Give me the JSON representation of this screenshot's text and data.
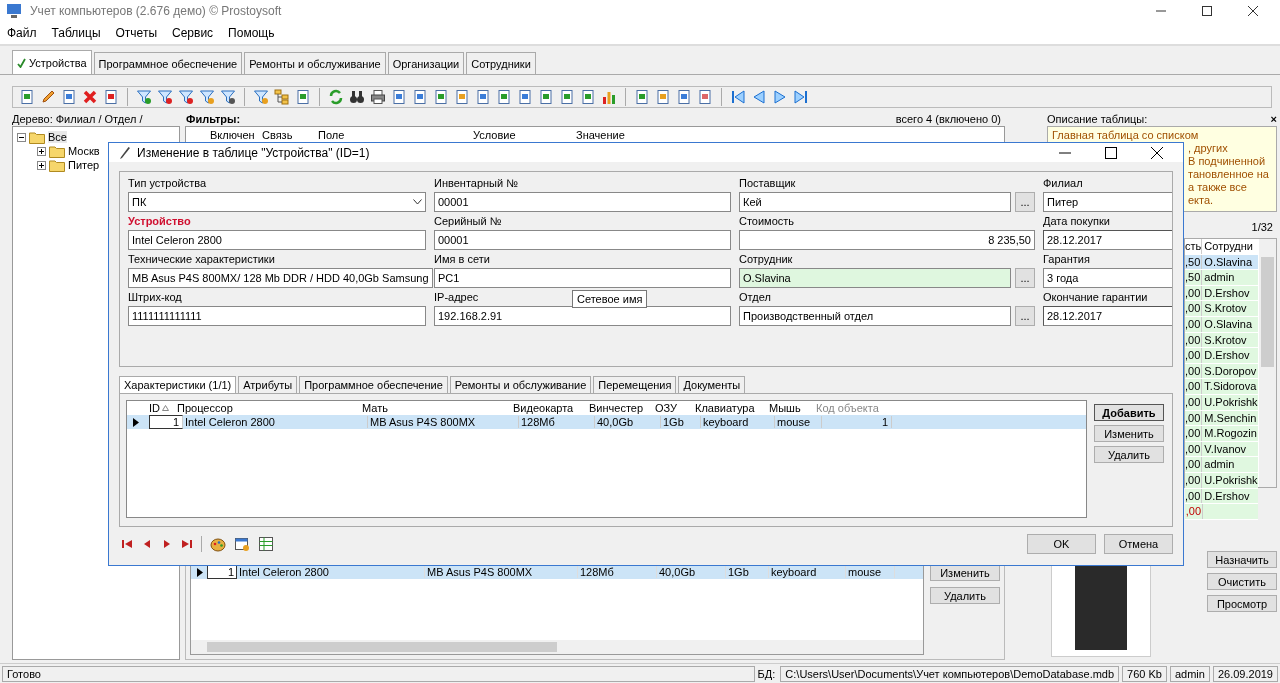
{
  "window": {
    "title": "Учет компьютеров (2.676 демо) © Prostoysoft"
  },
  "menu": [
    "Файл",
    "Таблицы",
    "Отчеты",
    "Сервис",
    "Помощь"
  ],
  "tabs": [
    {
      "label": "Устройства",
      "selected": true
    },
    {
      "label": "Программное обеспечение",
      "selected": false
    },
    {
      "label": "Ремонты и обслуживание",
      "selected": false
    },
    {
      "label": "Организации",
      "selected": false
    },
    {
      "label": "Сотрудники",
      "selected": false
    }
  ],
  "tree": {
    "title": "Дерево: Филиал / Отдел /",
    "items": [
      {
        "label": "Все",
        "expanded": true,
        "selected": true,
        "children": [
          {
            "label": "Москв",
            "expanded": false,
            "selected": false
          },
          {
            "label": "Питер",
            "expanded": false,
            "selected": false
          }
        ]
      }
    ]
  },
  "filters": {
    "title": "Фильтры:",
    "summary": "всего 4 (включено 0)",
    "columns": [
      "Включен",
      "Связь",
      "Поле",
      "Условие",
      "Значение"
    ]
  },
  "description": {
    "title": "Описание таблицы:",
    "close": "×",
    "lines": [
      "Главная таблица со списком",
      ", других",
      "В подчиненной",
      "тановленное на",
      "а также все",
      "екта."
    ]
  },
  "employees": {
    "counter": "1/32",
    "columns": [
      "сть",
      "Сотрудни"
    ],
    "rows": [
      {
        "cost": ",50",
        "name": "O.Slavina",
        "selected": true,
        "highlighted": false
      },
      {
        "cost": ",50",
        "name": "admin",
        "selected": false,
        "highlighted": false
      },
      {
        "cost": ",00",
        "name": "D.Ershov",
        "selected": false,
        "highlighted": false
      },
      {
        "cost": ",00",
        "name": "S.Krotov",
        "selected": false,
        "highlighted": false
      },
      {
        "cost": ",00",
        "name": "O.Slavina",
        "selected": false,
        "highlighted": false
      },
      {
        "cost": ",00",
        "name": "S.Krotov",
        "selected": false,
        "highlighted": false
      },
      {
        "cost": ",00",
        "name": "D.Ershov",
        "selected": false,
        "highlighted": false
      },
      {
        "cost": ",00",
        "name": "S.Doropov",
        "selected": false,
        "highlighted": false
      },
      {
        "cost": ",00",
        "name": "T.Sidorova",
        "selected": false,
        "highlighted": false
      },
      {
        "cost": ",00",
        "name": "U.Pokrishk",
        "selected": false,
        "highlighted": false
      },
      {
        "cost": ",00",
        "name": "M.Senchin",
        "selected": false,
        "highlighted": false
      },
      {
        "cost": ",00",
        "name": "M.Rogozin",
        "selected": false,
        "highlighted": false
      },
      {
        "cost": ",00",
        "name": "V.Ivanov",
        "selected": false,
        "highlighted": false
      },
      {
        "cost": ",00",
        "name": "admin",
        "selected": false,
        "highlighted": false
      },
      {
        "cost": ",00",
        "name": "U.Pokrishk",
        "selected": false,
        "highlighted": false
      },
      {
        "cost": ",00",
        "name": "D.Ershov",
        "selected": false,
        "highlighted": false
      },
      {
        "cost": ",00",
        "selected": false,
        "highlighted": true
      }
    ]
  },
  "devices": {
    "rows": [
      {
        "cells": [
          "1",
          "Intel Celeron 2800",
          "MB Asus P4S 800MX",
          "128Мб",
          "40,0Gb",
          "1Gb",
          "keyboard",
          "mouse"
        ],
        "selected": true
      }
    ],
    "buttons": [
      "Изменить",
      "Удалить"
    ]
  },
  "photo": {
    "buttons": [
      "Назначить",
      "Очистить",
      "Просмотр"
    ]
  },
  "dialog": {
    "title": "Изменение в таблице \"Устройства\" (ID=1)",
    "fields": [
      {
        "label": "Тип устройства",
        "value": "ПК",
        "kind": "dropdown",
        "required": false,
        "highlighted": false
      },
      {
        "label": "Инвентарный №",
        "value": "00001",
        "kind": "text",
        "required": false,
        "highlighted": false
      },
      {
        "label": "Поставщик",
        "value": "Кей",
        "kind": "lookup",
        "button": "...",
        "required": false,
        "highlighted": false
      },
      {
        "label": "Филиал",
        "value": "Питер",
        "kind": "text",
        "required": false,
        "highlighted": false
      },
      {
        "label": "Устройство",
        "value": "Intel Celeron 2800",
        "kind": "text",
        "required": true,
        "highlighted": false
      },
      {
        "label": "Серийный №",
        "value": "00001",
        "kind": "text",
        "required": false,
        "highlighted": false
      },
      {
        "label": "Стоимость",
        "value": "8 235,50",
        "kind": "number",
        "required": false,
        "highlighted": false
      },
      {
        "label": "Дата покупки",
        "value": "28.12.2017",
        "kind": "date",
        "required": false,
        "highlighted": false
      },
      {
        "label": "Технические характеристики",
        "value": "MB Asus P4S 800MX/ 128 Mb DDR / HDD 40,0Gb Samsung",
        "kind": "text",
        "required": false,
        "highlighted": false
      },
      {
        "label": "Имя в сети",
        "value": "PC1",
        "kind": "text",
        "required": false,
        "highlighted": false
      },
      {
        "label": "Сотрудник",
        "value": "O.Slavina",
        "kind": "lookup",
        "button": "...",
        "required": false,
        "highlighted": true
      },
      {
        "label": "Гарантия",
        "value": "3 года",
        "kind": "text",
        "required": false,
        "highlighted": false
      },
      {
        "label": "Штрих-код",
        "value": "1111111111111",
        "kind": "text",
        "required": false,
        "highlighted": false
      },
      {
        "label": "IP-адрес",
        "value": "192.168.2.91",
        "kind": "text",
        "required": false,
        "highlighted": false
      },
      {
        "label": "Отдел",
        "value": "Производственный отдел",
        "kind": "lookup",
        "button": "...",
        "required": false,
        "highlighted": false
      },
      {
        "label": "Окончание гарантии",
        "value": "28.12.2017",
        "kind": "date",
        "required": false,
        "highlighted": false
      }
    ],
    "tooltip": "Сетевое имя",
    "tabs": [
      {
        "label": "Характеристики (1/1)",
        "selected": true
      },
      {
        "label": "Атрибуты",
        "selected": false
      },
      {
        "label": "Программное обеспечение",
        "selected": false
      },
      {
        "label": "Ремонты и обслуживание",
        "selected": false
      },
      {
        "label": "Перемещения",
        "selected": false
      },
      {
        "label": "Документы",
        "selected": false
      }
    ],
    "grid": {
      "columns": [
        {
          "label": "ID",
          "dimmed": false
        },
        {
          "label": "Процессор",
          "dimmed": false
        },
        {
          "label": "Мать",
          "dimmed": false
        },
        {
          "label": "Видеокарта",
          "dimmed": false
        },
        {
          "label": "Винчестер",
          "dimmed": false
        },
        {
          "label": "ОЗУ",
          "dimmed": false
        },
        {
          "label": "Клавиатура",
          "dimmed": false
        },
        {
          "label": "Мышь",
          "dimmed": false
        },
        {
          "label": "Код объекта",
          "dimmed": true
        }
      ],
      "rows": [
        {
          "cells": [
            "1",
            "Intel Celeron 2800",
            "MB Asus P4S 800MX",
            "128Мб",
            "40,0Gb",
            "1Gb",
            "keyboard",
            "mouse",
            "1"
          ],
          "selected": true
        }
      ]
    },
    "buttons": [
      {
        "label": "Добавить",
        "default": true
      },
      {
        "label": "Изменить",
        "default": false
      },
      {
        "label": "Удалить",
        "default": false
      }
    ],
    "ok": "OK",
    "cancel": "Отмена"
  },
  "status_bar": {
    "status": "Готово",
    "db_label": "БД:",
    "path": "C:\\Users\\User\\Documents\\Учет компьютеров\\DemoDatabase.mdb",
    "size": "760 Kb",
    "user": "admin",
    "date": "26.09.2019"
  }
}
